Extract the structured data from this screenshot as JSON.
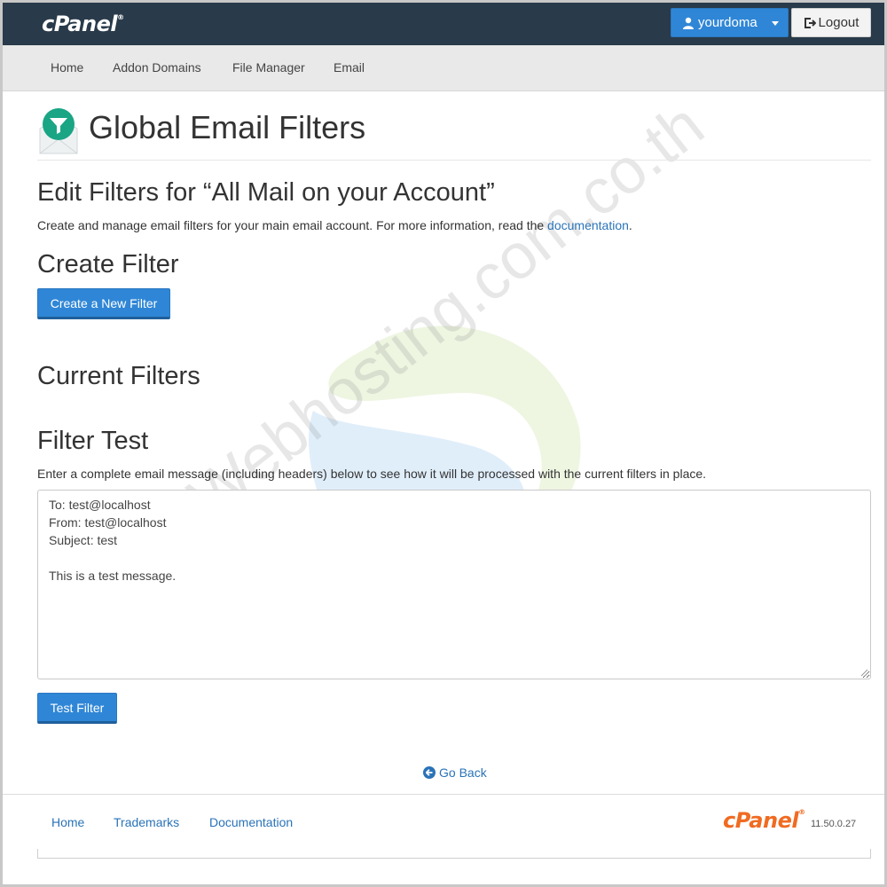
{
  "header": {
    "logo_text": "cPanel",
    "user_label": "yourdoma",
    "logout_label": "Logout"
  },
  "nav": {
    "items": [
      "Home",
      "Addon Domains",
      "File Manager",
      "Email"
    ]
  },
  "page": {
    "title": "Global Email Filters",
    "edit_heading": "Edit Filters for “All Mail on your Account”",
    "description_prefix": "Create and manage email filters for your main email account. For more information, read the ",
    "description_link": "documentation",
    "description_suffix": ".",
    "create_heading": "Create Filter",
    "create_button": "Create a New Filter",
    "current_heading": "Current Filters",
    "test_heading": "Filter Test",
    "test_description": "Enter a complete email message (including headers) below to see how it will be processed with the current filters in place.",
    "test_message": "To: test@localhost\nFrom: test@localhost\nSubject: test\n\nThis is a test message.",
    "test_button": "Test Filter",
    "go_back": "Go Back"
  },
  "footer": {
    "links": [
      "Home",
      "Trademarks",
      "Documentation"
    ],
    "logo_text": "cPanel",
    "version": "11.50.0.27"
  },
  "watermark": {
    "text": "Webhosting.com.co.th"
  },
  "colors": {
    "topbar": "#293a4a",
    "accent_blue": "#2f86d6",
    "link": "#2a73b8",
    "footer_logo": "#f06b22",
    "icon_green": "#1aa585"
  }
}
